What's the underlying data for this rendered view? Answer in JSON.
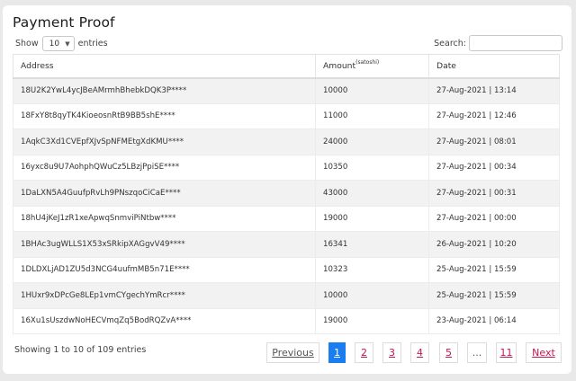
{
  "page": {
    "title": "Payment Proof"
  },
  "length_menu": {
    "prefix": "Show",
    "selected": "10",
    "suffix": "entries"
  },
  "search": {
    "label": "Search:",
    "value": ""
  },
  "table": {
    "columns": {
      "address": "Address",
      "amount": "Amount",
      "amount_unit": "(satoshi)",
      "date": "Date"
    },
    "rows": [
      {
        "address": "18U2K2YwL4ycJBeAMrmhBhebkDQK3P****",
        "amount": "10000",
        "date": "27-Aug-2021 | 13:14"
      },
      {
        "address": "18FxY8t8qyTK4KioeosnRtB9BB5shE****",
        "amount": "11000",
        "date": "27-Aug-2021 | 12:46"
      },
      {
        "address": "1AqkC3Xd1CVEpfXJvSpNFMEtgXdKMU****",
        "amount": "24000",
        "date": "27-Aug-2021 | 08:01"
      },
      {
        "address": "16yxc8u9U7AohphQWuCz5LBzjPpiSE****",
        "amount": "10350",
        "date": "27-Aug-2021 | 00:34"
      },
      {
        "address": "1DaLXN5A4GuufpRvLh9PNszqoCiCaE****",
        "amount": "43000",
        "date": "27-Aug-2021 | 00:31"
      },
      {
        "address": "18hU4jKeJ1zR1xeApwqSnmviPiNtbw****",
        "amount": "19000",
        "date": "27-Aug-2021 | 00:00"
      },
      {
        "address": "1BHAc3ugWLLS1X53xSRkipXAGgvV49****",
        "amount": "16341",
        "date": "26-Aug-2021 | 10:20"
      },
      {
        "address": "1DLDXLjAD1ZU5d3NCG4uufmMB5n71E****",
        "amount": "10323",
        "date": "25-Aug-2021 | 15:59"
      },
      {
        "address": "1HUxr9xDPcGe8LEp1vmCYgechYmRcr****",
        "amount": "10000",
        "date": "25-Aug-2021 | 15:59"
      },
      {
        "address": "16Xu1sUszdwNoHECVmqZq5BodRQZvA****",
        "amount": "19000",
        "date": "23-Aug-2021 | 06:14"
      }
    ]
  },
  "info": "Showing 1 to 10 of 109 entries",
  "pagination": {
    "previous": "Previous",
    "next": "Next",
    "pages": [
      "1",
      "2",
      "3",
      "4",
      "5",
      "...",
      "11"
    ],
    "current": "1"
  },
  "colors": {
    "active_page": "#1a7df0",
    "link": "#c0174f"
  }
}
